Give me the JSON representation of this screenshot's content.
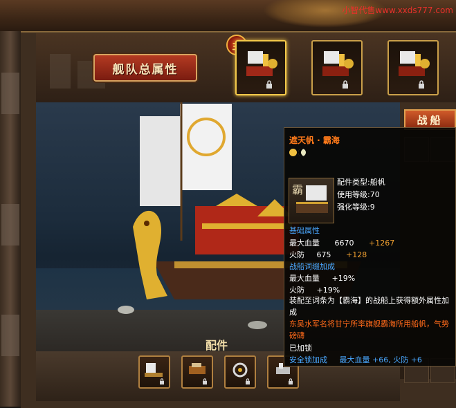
{
  "watermark": "小智代售www.xxds777.com",
  "header": {
    "fleet_button_label": "舰队总属性",
    "lord_badge": "主"
  },
  "colors": {
    "accent_gold": "#caa04a",
    "tooltip_title": "#ff7a1a",
    "stat_bonus": "#f0a030",
    "section_blue": "#4aa8ff",
    "lore_orange": "#ff6a1a"
  },
  "ship_slots": [
    {
      "icon": "warship-icon",
      "locked": true,
      "selected": true
    },
    {
      "icon": "warship-icon",
      "locked": true,
      "selected": false
    },
    {
      "icon": "warship-icon",
      "locked": true,
      "selected": false
    }
  ],
  "warship_tab_label": "战船",
  "parts": {
    "title": "配件",
    "slots": [
      {
        "icon": "ship-part-icon",
        "locked": true
      },
      {
        "icon": "ship-part-icon",
        "locked": true
      },
      {
        "icon": "ship-part-icon",
        "locked": true
      },
      {
        "icon": "ship-part-icon",
        "locked": true
      }
    ]
  },
  "tooltip": {
    "title": "遮天帆 · 霸海",
    "item_icon_label": "霸",
    "info": {
      "type": "配件类型:船帆",
      "use_level": "使用等级:70",
      "enhance_level": "强化等级:9"
    },
    "base_section": "基础属性",
    "base_stats": [
      {
        "name": "最大血量",
        "value": "6670",
        "bonus": "+1267"
      },
      {
        "name": "火防",
        "value": "675",
        "bonus": "+128"
      }
    ],
    "affix_section": "战船词缀加成",
    "affix_stats": [
      {
        "name": "最大血量",
        "value": "+19%"
      },
      {
        "name": "火防",
        "value": "+19%"
      }
    ],
    "set_text": "装配至词条为【霸海】的战船上获得额外属性加成",
    "lore": "东吴水军名将甘宁所率旗舰霸海所用船帆，气势磅礴",
    "status": "已加锁",
    "lock_bonus_label": "安全锁加成",
    "lock_bonus_value": "最大血量 +66, 火防 +6"
  }
}
